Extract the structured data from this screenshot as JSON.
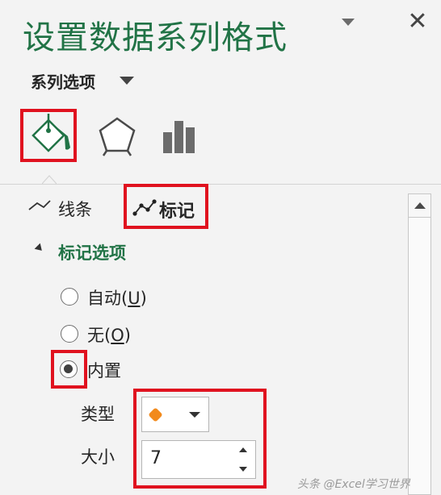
{
  "pane": {
    "title": "设置数据系列格式",
    "close_symbol": "✕",
    "series_options_label": "系列选项",
    "icons": {
      "title_menu": "dropdown-caret-icon",
      "close": "close-icon",
      "fill_line_tab": "paint-bucket-icon",
      "effects_tab": "pentagon-icon",
      "size_props_tab": "bar-chart-icon"
    }
  },
  "subtabs": {
    "line": "线条",
    "marker": "标记"
  },
  "marker_options": {
    "section_title": "标记选项",
    "radios": [
      {
        "label": "自动",
        "accel": "(U)",
        "checked": false
      },
      {
        "label": "无",
        "accel": "(O)",
        "checked": false
      },
      {
        "label": "内置",
        "accel": "",
        "checked": true
      }
    ],
    "type_label": "类型",
    "size_label": "大小",
    "size_value": "7",
    "marker_color": "#f28a1c"
  },
  "colors": {
    "accent_green": "#217346",
    "highlight_red": "#e0121f"
  },
  "watermark": "头条 @Excel学习世界"
}
